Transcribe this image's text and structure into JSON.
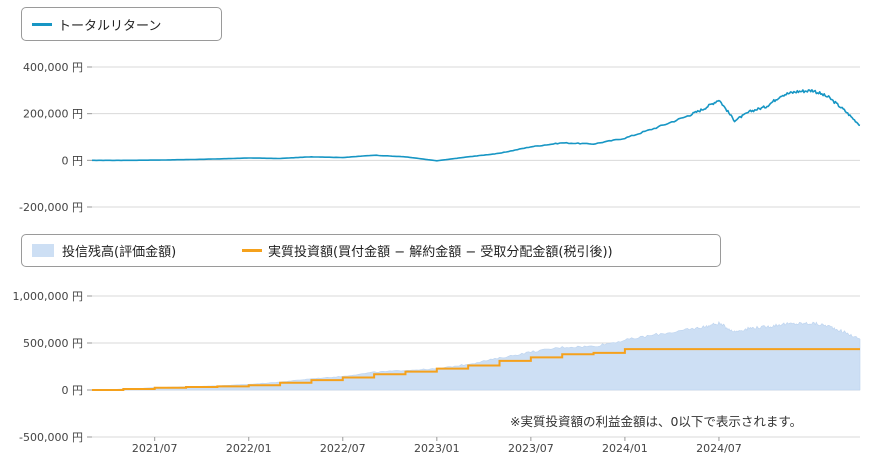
{
  "colors": {
    "total_return": "#1796c4",
    "holdings": "#cddff4",
    "invested": "#f5a11c",
    "grid": "#d9d9d9",
    "axis": "#999999"
  },
  "legend_top": {
    "items": [
      {
        "label": "トータルリターン",
        "color": "#1796c4"
      }
    ]
  },
  "legend_bottom": {
    "items": [
      {
        "label": "投信残高(評価金額)",
        "color": "#cddff4"
      },
      {
        "label": "実質投資額(買付金額 − 解約金額 − 受取分配金額(税引後))",
        "color": "#f5a11c"
      }
    ]
  },
  "note": "※実質投資額の利益金額は、0以下で表示されます。",
  "chart_data": [
    {
      "type": "line",
      "x_unit": "month",
      "xlim": [
        "2021-03",
        "2025-04"
      ],
      "ylim": [
        -200000,
        400000
      ],
      "y_ticks": [
        400000,
        200000,
        0,
        -200000
      ],
      "y_tick_labels": [
        "400,000 円",
        "200,000 円",
        "0 円",
        "-200,000 円"
      ],
      "grid": true,
      "legend": "top-left",
      "series": [
        {
          "name": "トータルリターン",
          "x": [
            "2021-03",
            "2021-05",
            "2021-07",
            "2021-09",
            "2021-11",
            "2022-01",
            "2022-03",
            "2022-05",
            "2022-07",
            "2022-09",
            "2022-11",
            "2023-01",
            "2023-03",
            "2023-05",
            "2023-07",
            "2023-09",
            "2023-11",
            "2024-01",
            "2024-03",
            "2024-05",
            "2024-06",
            "2024-07",
            "2024-08",
            "2024-09",
            "2024-10",
            "2024-11",
            "2024-12",
            "2025-01",
            "2025-02",
            "2025-03",
            "2025-04"
          ],
          "values": [
            0,
            0,
            1000,
            3000,
            6000,
            10000,
            8000,
            15000,
            12000,
            22000,
            15000,
            -2000,
            15000,
            30000,
            58000,
            75000,
            70000,
            95000,
            140000,
            190000,
            220000,
            260000,
            170000,
            210000,
            230000,
            280000,
            295000,
            300000,
            270000,
            215000,
            150000
          ]
        }
      ]
    },
    {
      "type": "area",
      "x_unit": "month",
      "xlim": [
        "2021-03",
        "2025-04"
      ],
      "ylim": [
        -500000,
        1000000
      ],
      "y_ticks": [
        1000000,
        500000,
        0,
        -500000
      ],
      "y_tick_labels": [
        "1,000,000 円",
        "500,000 円",
        "0 円",
        "-500,000 円"
      ],
      "x_tick_labels": [
        "2021/07",
        "2022/01",
        "2022/07",
        "2023/01",
        "2023/07",
        "2024/01",
        "2024/07"
      ],
      "grid": true,
      "legend": "top-left",
      "series": [
        {
          "name": "投信残高(評価金額)",
          "type": "area",
          "x": [
            "2021-03",
            "2021-05",
            "2021-07",
            "2021-09",
            "2021-11",
            "2022-01",
            "2022-03",
            "2022-05",
            "2022-07",
            "2022-09",
            "2022-11",
            "2023-01",
            "2023-03",
            "2023-05",
            "2023-07",
            "2023-09",
            "2023-11",
            "2024-01",
            "2024-03",
            "2024-05",
            "2024-06",
            "2024-07",
            "2024-08",
            "2024-09",
            "2024-10",
            "2024-11",
            "2024-12",
            "2025-01",
            "2025-02",
            "2025-03",
            "2025-04"
          ],
          "values": [
            0,
            10000,
            25000,
            35000,
            45000,
            60000,
            85000,
            120000,
            145000,
            190000,
            210000,
            225000,
            275000,
            340000,
            405000,
            455000,
            465000,
            530000,
            590000,
            640000,
            670000,
            710000,
            620000,
            660000,
            670000,
            700000,
            705000,
            710000,
            680000,
            615000,
            540000
          ]
        },
        {
          "name": "実質投資額(買付金額 − 解約金額 − 受取分配金額(税引後))",
          "type": "step",
          "x": [
            "2021-03",
            "2021-05",
            "2021-07",
            "2021-09",
            "2021-11",
            "2022-01",
            "2022-03",
            "2022-05",
            "2022-07",
            "2022-09",
            "2022-11",
            "2023-01",
            "2023-03",
            "2023-05",
            "2023-07",
            "2023-09",
            "2023-11",
            "2024-01",
            "2024-03",
            "2024-05",
            "2024-07",
            "2024-09",
            "2024-11",
            "2025-01",
            "2025-04"
          ],
          "values": [
            0,
            10000,
            24000,
            32000,
            39000,
            50000,
            77000,
            105000,
            133000,
            168000,
            195000,
            227000,
            260000,
            310000,
            347000,
            380000,
            395000,
            435000,
            435000,
            435000,
            435000,
            435000,
            435000,
            435000,
            435000
          ]
        }
      ]
    }
  ]
}
